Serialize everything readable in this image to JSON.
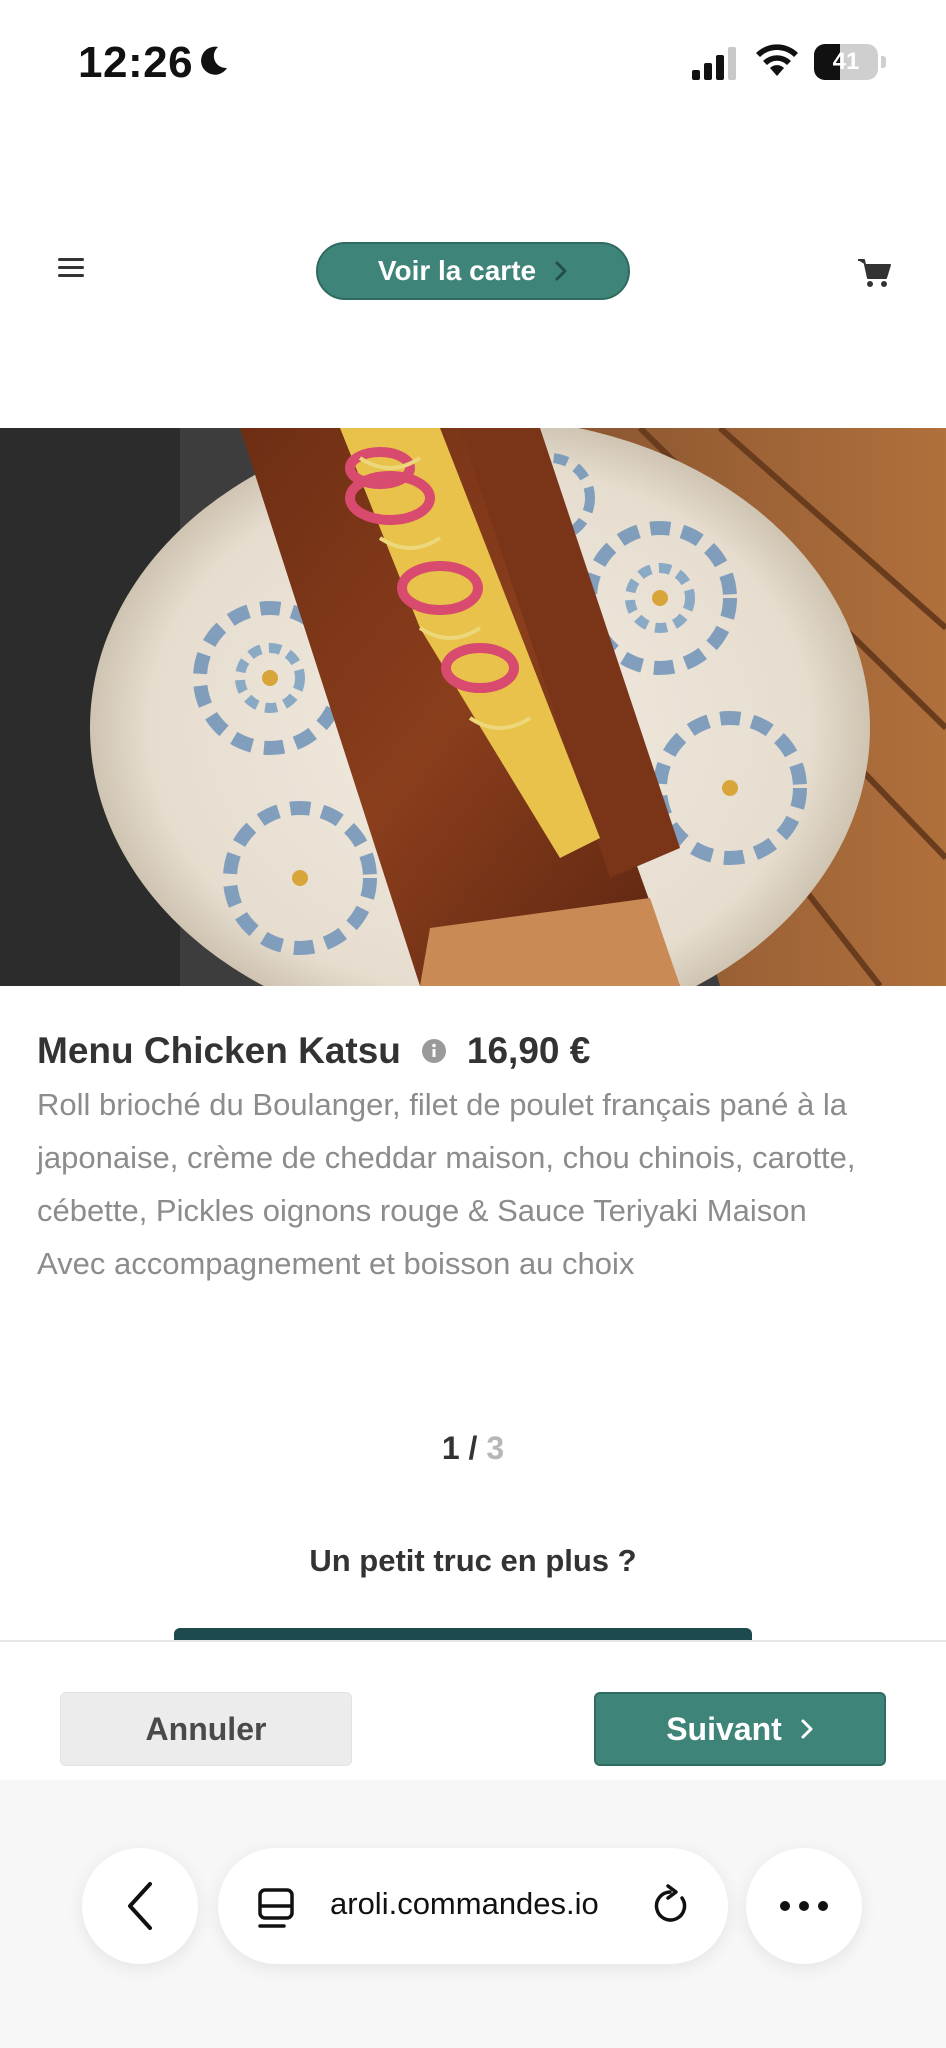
{
  "status_bar": {
    "time": "12:26",
    "battery_level": 41,
    "battery_label": "41"
  },
  "header": {
    "menu_icon": "hamburger-menu-icon",
    "voir_la_carte_label": "Voir la carte",
    "cart_icon": "shopping-cart-icon"
  },
  "product": {
    "image_description_icon": "sandwich-photo",
    "name": "Menu Chicken Katsu",
    "price": "16,90 €",
    "description": "Roll brioché du Boulanger, filet de poulet français pané à la japonaise, crème de cheddar maison, chou chinois, carotte, cébette, Pickles oignons rouge & Sauce Teriyaki Maison",
    "extra_line": "Avec accompagnement et boisson au choix"
  },
  "pagination": {
    "current": "1",
    "separator": " / ",
    "total": "3"
  },
  "extra_section": {
    "title": "Un petit truc en plus ?"
  },
  "actions": {
    "cancel_label": "Annuler",
    "next_label": "Suivant"
  },
  "browser": {
    "url": "aroli.commandes.io"
  },
  "colors": {
    "accent": "#3f8478",
    "text_dark": "#333333",
    "text_muted": "#8c8c8c"
  }
}
